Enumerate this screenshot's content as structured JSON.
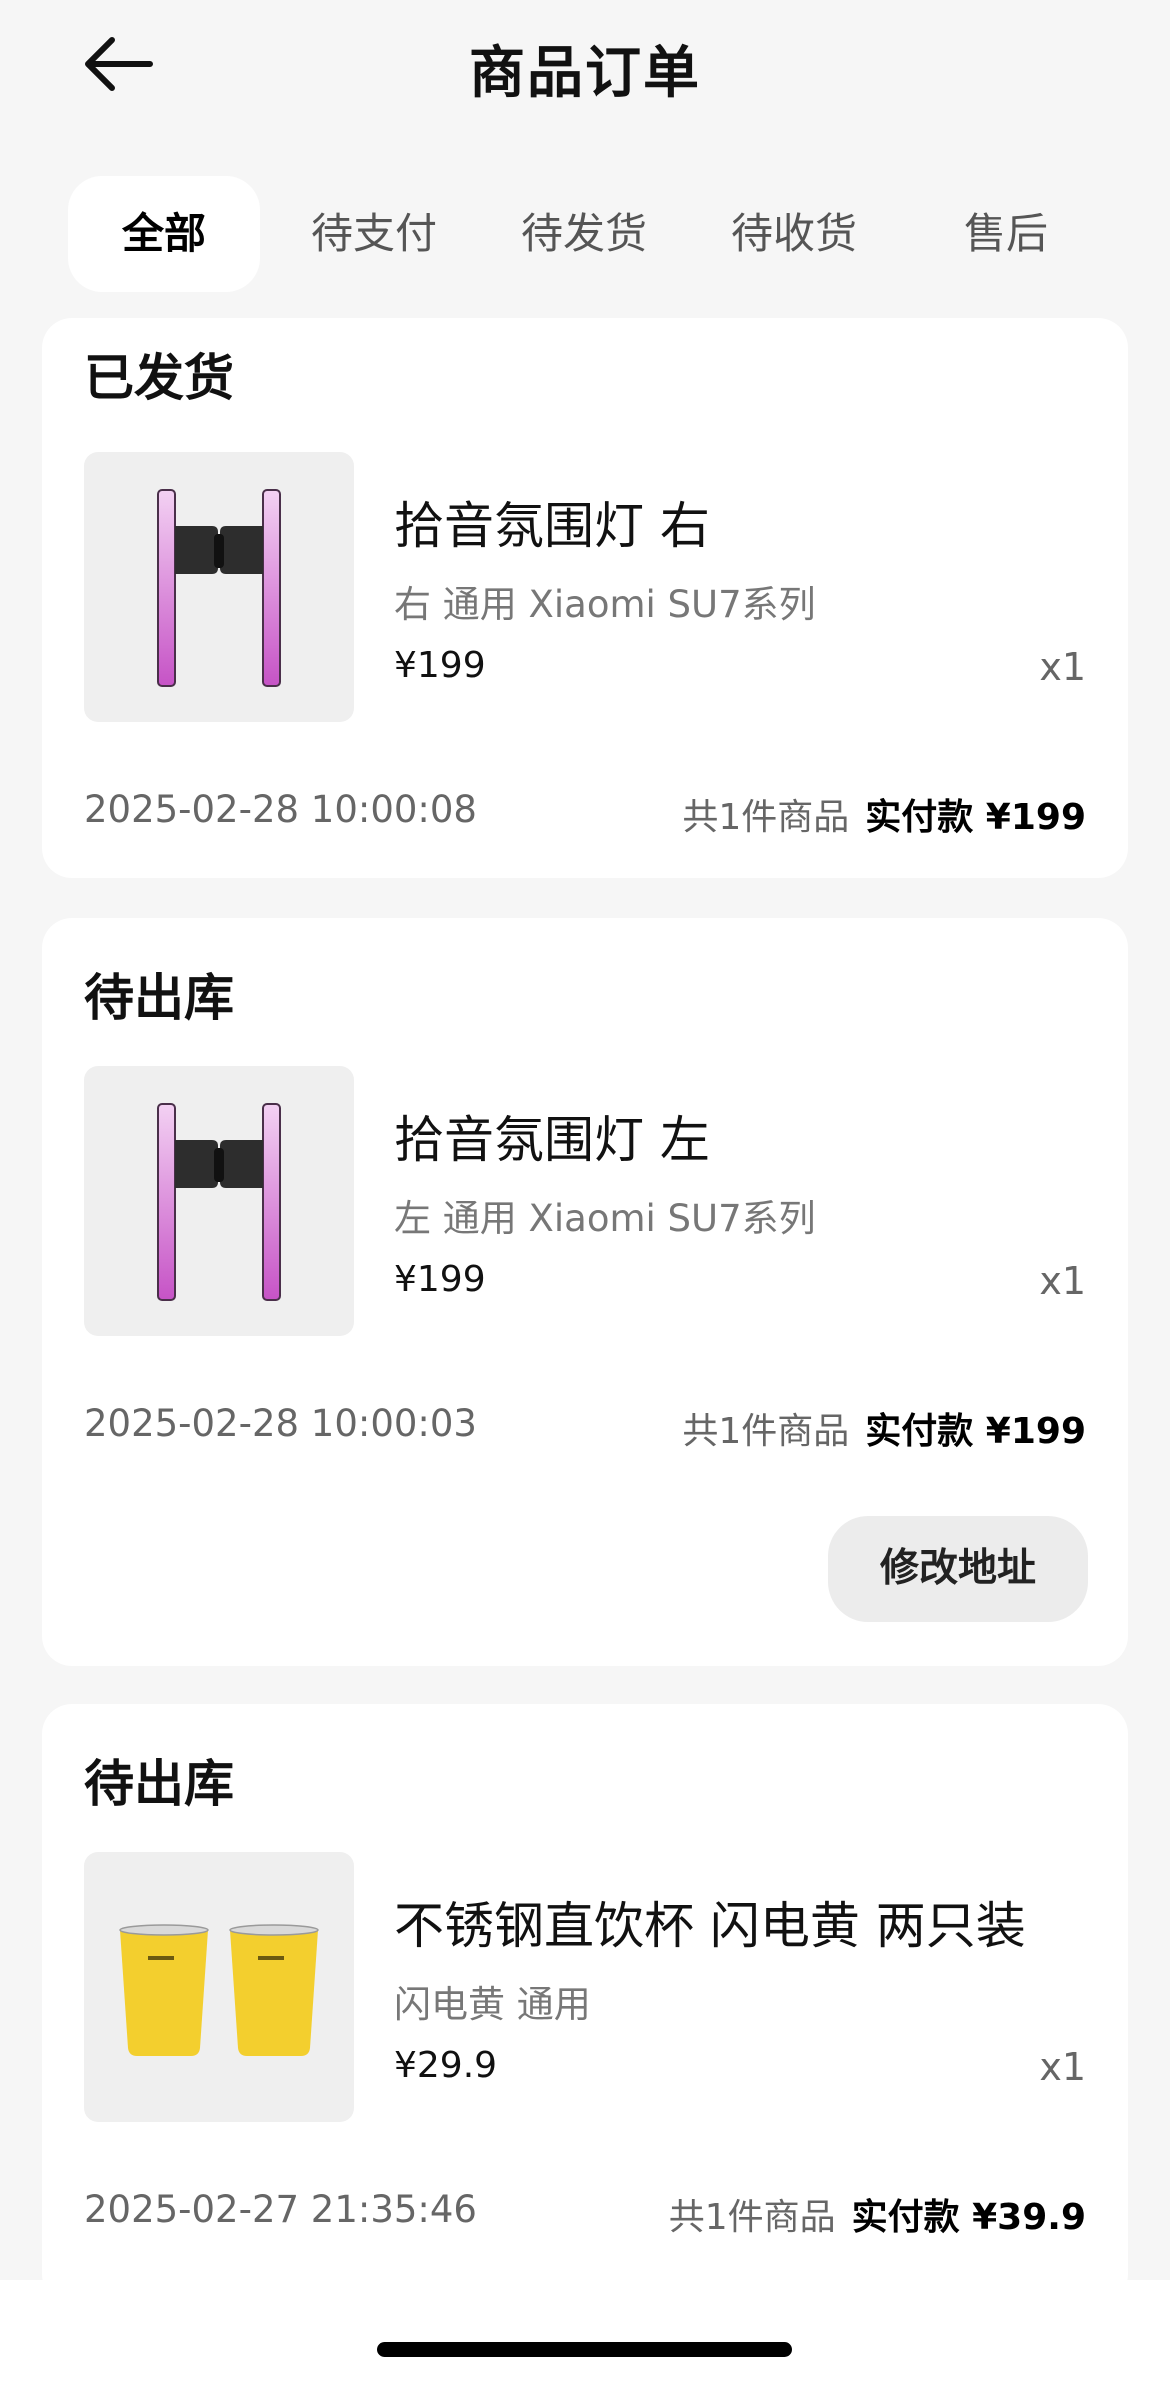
{
  "header": {
    "title": "商品订单",
    "back_icon": "arrow-left-icon"
  },
  "tabs": [
    {
      "label": "全部",
      "active": true
    },
    {
      "label": "待支付",
      "active": false
    },
    {
      "label": "待发货",
      "active": false
    },
    {
      "label": "待收货",
      "active": false
    },
    {
      "label": "售后",
      "active": false
    }
  ],
  "orders": [
    {
      "status": "已发货",
      "product": {
        "name": "拾音氛围灯 右",
        "spec": "右 通用  Xiaomi SU7系列",
        "price": "¥199",
        "qty": "x1",
        "image": "ambient-light-image"
      },
      "time": "2025-02-28 10:00:08",
      "count_text": "共1件商品",
      "paid_text": "实付款 ¥199"
    },
    {
      "status": "待出库",
      "product": {
        "name": "拾音氛围灯 左",
        "spec": "左 通用  Xiaomi SU7系列",
        "price": "¥199",
        "qty": "x1",
        "image": "ambient-light-image"
      },
      "time": "2025-02-28 10:00:03",
      "count_text": "共1件商品",
      "paid_text": "实付款 ¥199",
      "action_label": "修改地址"
    },
    {
      "status": "待出库",
      "product": {
        "name": "不锈钢直饮杯 闪电黄 两只装",
        "spec": "闪电黄 通用",
        "price": "¥29.9",
        "qty": "x1",
        "image": "yellow-cups-image"
      },
      "time": "2025-02-27 21:35:46",
      "count_text": "共1件商品",
      "paid_text": "实付款 ¥39.9"
    }
  ],
  "colors": {
    "page_bg": "#f6f6f6",
    "card_bg": "#ffffff",
    "light_pink": "#f1c6f1",
    "light_purple": "#c85cc8",
    "cup_yellow": "#f3cf2e"
  }
}
